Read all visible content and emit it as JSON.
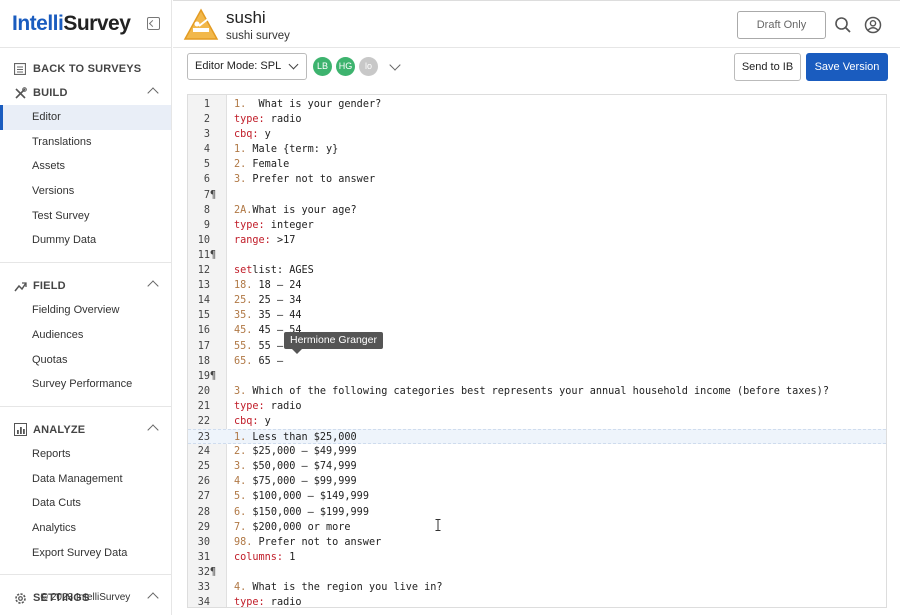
{
  "app": {
    "logo_part1": "Intelli",
    "logo_part2": "Survey"
  },
  "sidebar": {
    "back_label": "BACK TO SURVEYS",
    "sections": [
      {
        "title": "BUILD",
        "icon": "tools-icon",
        "items": [
          "Editor",
          "Translations",
          "Assets",
          "Versions",
          "Test Survey",
          "Dummy Data"
        ],
        "active": "Editor"
      },
      {
        "title": "FIELD",
        "icon": "field-icon",
        "items": [
          "Fielding Overview",
          "Audiences",
          "Quotas",
          "Survey Performance"
        ]
      },
      {
        "title": "ANALYZE",
        "icon": "chart-icon",
        "items": [
          "Reports",
          "Data Management",
          "Data Cuts",
          "Analytics",
          "Export Survey Data"
        ]
      },
      {
        "title": "SETTINGS",
        "icon": "gear-icon",
        "items": []
      }
    ],
    "copyright": "© 2023 IntelliSurvey"
  },
  "header": {
    "title": "sushi",
    "subtitle": "sushi survey",
    "status_button": "Draft Only",
    "status_color": "#666666"
  },
  "toolbar": {
    "mode_label": "Editor Mode: SPL",
    "avatars": [
      {
        "initials": "LB",
        "color": "#3db36e"
      },
      {
        "initials": "HG",
        "color": "#3db36e"
      },
      {
        "initials": "lo",
        "color": "#c8c8c8"
      }
    ],
    "send_button": "Send to IB",
    "save_button": "Save Version",
    "accent_color": "#1a5cbf"
  },
  "editor": {
    "tooltip": "Hermione Granger",
    "highlighted_line": 23,
    "lines": [
      {
        "n": "1",
        "p": "",
        "t": [
          [
            "num",
            "1."
          ],
          [
            "",
            "  What is your gender?"
          ]
        ]
      },
      {
        "n": "2",
        "p": "",
        "t": [
          [
            "kw",
            "type:"
          ],
          [
            "",
            " radio"
          ]
        ]
      },
      {
        "n": "3",
        "p": "",
        "t": [
          [
            "kw",
            "cbq:"
          ],
          [
            "",
            " y"
          ]
        ]
      },
      {
        "n": "4",
        "p": "",
        "t": [
          [
            "num",
            "1."
          ],
          [
            "",
            " Male {term: y}"
          ]
        ]
      },
      {
        "n": "5",
        "p": "",
        "t": [
          [
            "num",
            "2."
          ],
          [
            "",
            " Female"
          ]
        ]
      },
      {
        "n": "6",
        "p": "",
        "t": [
          [
            "num",
            "3."
          ],
          [
            "",
            " Prefer not to answer"
          ]
        ]
      },
      {
        "n": "7",
        "p": "¶",
        "t": []
      },
      {
        "n": "8",
        "p": "",
        "t": [
          [
            "num",
            "2A."
          ],
          [
            " ",
            "What is your age?"
          ]
        ]
      },
      {
        "n": "9",
        "p": "",
        "t": [
          [
            "kw",
            "type:"
          ],
          [
            "",
            " integer"
          ]
        ]
      },
      {
        "n": "10",
        "p": "",
        "t": [
          [
            "kw",
            "range:"
          ],
          [
            "",
            " >17"
          ]
        ]
      },
      {
        "n": "11",
        "p": "¶",
        "t": []
      },
      {
        "n": "12",
        "p": "",
        "t": [
          [
            "kw",
            "set"
          ],
          [
            "",
            "list: AGES"
          ]
        ]
      },
      {
        "n": "13",
        "p": "",
        "t": [
          [
            "num",
            "18."
          ],
          [
            "",
            " 18 – 24"
          ]
        ]
      },
      {
        "n": "14",
        "p": "",
        "t": [
          [
            "num",
            "25."
          ],
          [
            "",
            " 25 – 34"
          ]
        ]
      },
      {
        "n": "15",
        "p": "",
        "t": [
          [
            "num",
            "35."
          ],
          [
            "",
            " 35 – 44"
          ]
        ]
      },
      {
        "n": "16",
        "p": "",
        "t": [
          [
            "num",
            "45."
          ],
          [
            "",
            " 45 – 54"
          ]
        ]
      },
      {
        "n": "17",
        "p": "",
        "t": [
          [
            "num",
            "55."
          ],
          [
            "",
            " 55 – 64"
          ]
        ]
      },
      {
        "n": "18",
        "p": "",
        "t": [
          [
            "num",
            "65."
          ],
          [
            "",
            " 65 –"
          ]
        ]
      },
      {
        "n": "19",
        "p": "¶",
        "t": []
      },
      {
        "n": "20",
        "p": "",
        "t": [
          [
            "num",
            "3."
          ],
          [
            "",
            " Which of the following categories best represents your annual household income (before taxes)?"
          ]
        ]
      },
      {
        "n": "21",
        "p": "",
        "t": [
          [
            "kw",
            "type:"
          ],
          [
            "",
            " radio"
          ]
        ]
      },
      {
        "n": "22",
        "p": "",
        "t": [
          [
            "kw",
            "cbq:"
          ],
          [
            "",
            " y"
          ]
        ]
      },
      {
        "n": "23",
        "p": "",
        "t": [
          [
            "num",
            "1."
          ],
          [
            "",
            " Less than $25,000"
          ]
        ]
      },
      {
        "n": "24",
        "p": "",
        "t": [
          [
            "num",
            "2."
          ],
          [
            "",
            " $25,000 – $49,999"
          ]
        ]
      },
      {
        "n": "25",
        "p": "",
        "t": [
          [
            "num",
            "3."
          ],
          [
            "",
            " $50,000 – $74,999"
          ]
        ]
      },
      {
        "n": "26",
        "p": "",
        "t": [
          [
            "num",
            "4."
          ],
          [
            "",
            " $75,000 – $99,999"
          ]
        ]
      },
      {
        "n": "27",
        "p": "",
        "t": [
          [
            "num",
            "5."
          ],
          [
            "",
            " $100,000 – $149,999"
          ]
        ]
      },
      {
        "n": "28",
        "p": "",
        "t": [
          [
            "num",
            "6."
          ],
          [
            "",
            " $150,000 – $199,999"
          ]
        ]
      },
      {
        "n": "29",
        "p": "",
        "t": [
          [
            "num",
            "7."
          ],
          [
            "",
            " $200,000 or more"
          ]
        ]
      },
      {
        "n": "30",
        "p": "",
        "t": [
          [
            "num",
            "98."
          ],
          [
            "",
            " Prefer not to answer"
          ]
        ]
      },
      {
        "n": "31",
        "p": "",
        "t": [
          [
            "kw",
            "columns:"
          ],
          [
            "",
            " 1"
          ]
        ]
      },
      {
        "n": "32",
        "p": "¶",
        "t": []
      },
      {
        "n": "33",
        "p": "",
        "t": [
          [
            "num",
            "4."
          ],
          [
            "",
            " What is the region you live in?"
          ]
        ]
      },
      {
        "n": "34",
        "p": "",
        "t": [
          [
            "kw",
            "type:"
          ],
          [
            "",
            " radio"
          ]
        ]
      }
    ]
  }
}
